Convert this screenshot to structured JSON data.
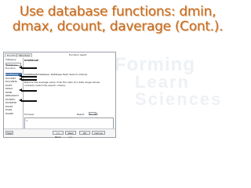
{
  "slide": {
    "title_line1": "Use database functions: dmin,",
    "title_line2": "dmax, dcount, daverage (Cont.)."
  },
  "watermark": {
    "line1": "Forming",
    "line2": "Learn Sciences"
  },
  "dialog": {
    "tabs": [
      "Functions",
      "Structure"
    ],
    "function_label": "Function result",
    "category_label": "Category",
    "category_value": "Database",
    "function_list_label": "Function",
    "functions": [
      "DAVERAGE",
      "DCOUNT",
      "DCOUNTA",
      "DGET",
      "DMAX",
      "DMIN",
      "DPRODUCT",
      "DSTDEV",
      "DSTDEVP",
      "DSUM",
      "DVAR",
      "DVARP"
    ],
    "selected_function": "DAVERAGE",
    "detail_title": "DAVERAGE",
    "detail_signature": "DAVERAGE(Database; Database field; Search criteria)",
    "detail_description": "Returns the average value of all the cells of a data range whose contents match the search criteria.",
    "formula_label": "Formula",
    "result_label": "Result",
    "result_value": "Err:502",
    "formula_value": "=",
    "buttons": {
      "help": "Help",
      "back": "<< Back",
      "next": "Next >>",
      "ok": "OK",
      "cancel": "Cancel"
    }
  },
  "colors": {
    "title": "#c86a1e",
    "selection": "#3f6fa6",
    "arrow": "#111111"
  }
}
